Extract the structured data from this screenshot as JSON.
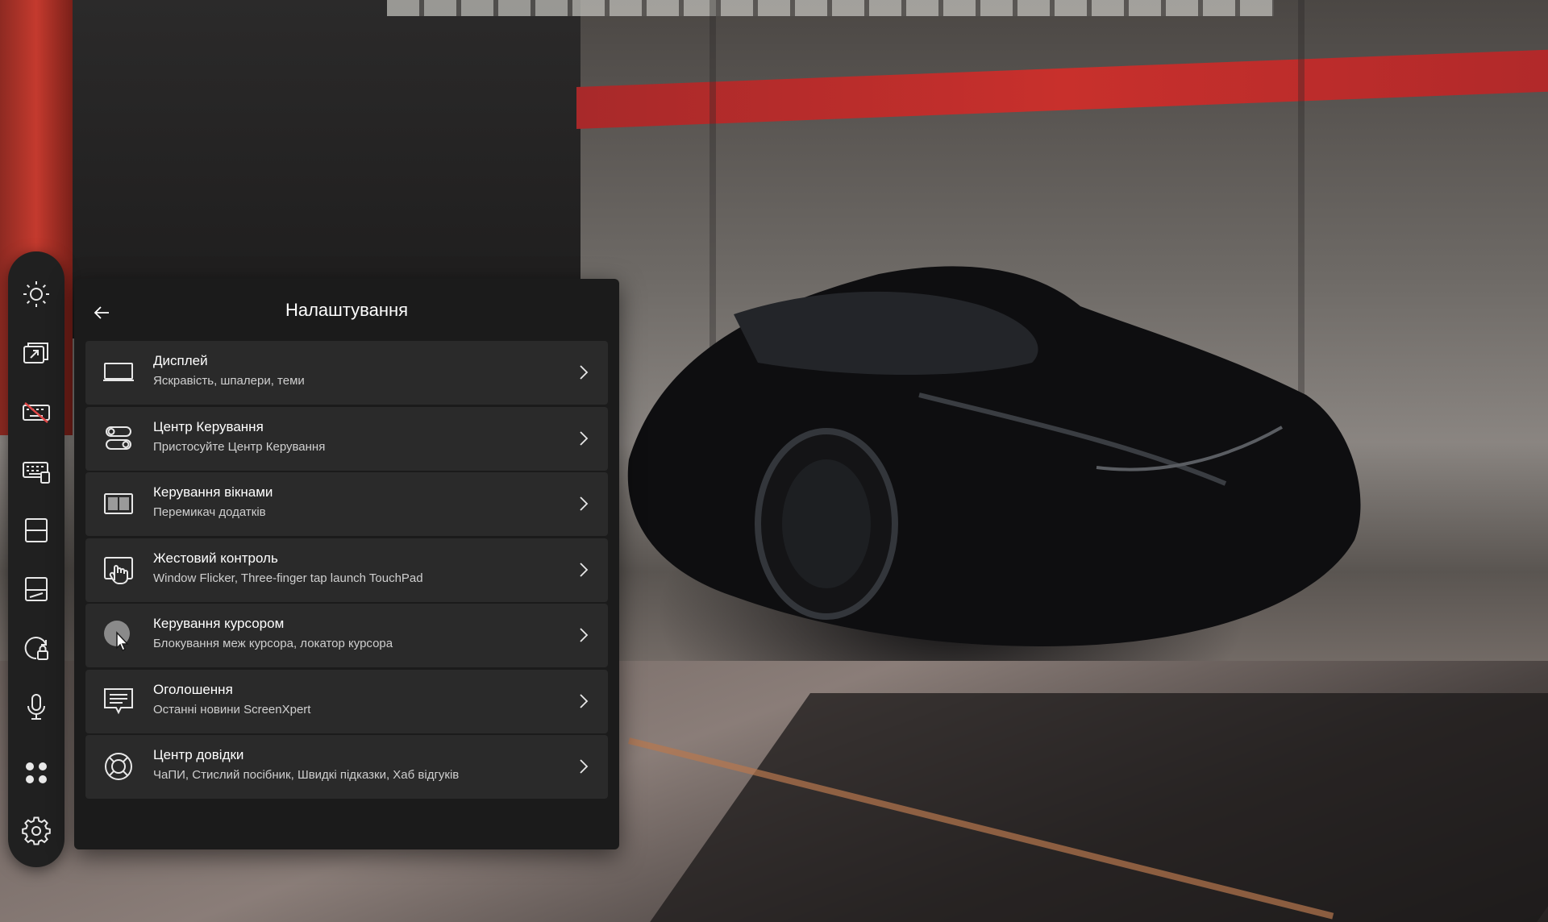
{
  "wallpaper": {
    "description_icon": "sports-car-wallpaper"
  },
  "toolbar": {
    "buttons": [
      {
        "name": "brightness-icon",
        "icon": "sun"
      },
      {
        "name": "window-switch-icon",
        "icon": "windows-stack-arrow"
      },
      {
        "name": "keyboard-off-icon",
        "icon": "keyboard-slash"
      },
      {
        "name": "keyboard-icon",
        "icon": "keyboard"
      },
      {
        "name": "screen-split-icon",
        "icon": "split-horizontal"
      },
      {
        "name": "screen-pad-icon",
        "icon": "screenpad"
      },
      {
        "name": "app-lock-icon",
        "icon": "circular-lock"
      },
      {
        "name": "microphone-icon",
        "icon": "microphone"
      },
      {
        "name": "apps-icon",
        "icon": "four-dots"
      },
      {
        "name": "settings-gear-icon",
        "icon": "gear"
      }
    ]
  },
  "panel": {
    "title": "Налаштування",
    "back_icon": "arrow-left",
    "items": [
      {
        "title": "Дисплей",
        "subtitle": "Яскравість, шпалери, теми",
        "icon": "display"
      },
      {
        "title": "Центр Керування",
        "subtitle": "Пристосуйте Центр Керування",
        "icon": "toggles"
      },
      {
        "title": "Керування вікнами",
        "subtitle": "Перемикач додатків",
        "icon": "window-split"
      },
      {
        "title": "Жестовий контроль",
        "subtitle": "Window Flicker, Three-finger tap launch TouchPad",
        "icon": "gesture-hand"
      },
      {
        "title": "Керування курсором",
        "subtitle": "Блокування меж курсора, локатор курсора",
        "icon": "cursor"
      },
      {
        "title": "Оголошення",
        "subtitle": "Останні новини ScreenXpert",
        "icon": "announcement"
      },
      {
        "title": "Центр довідки",
        "subtitle": "ЧаПИ, Стислий посібник, Швидкі підказки, Хаб відгуків",
        "icon": "lifebuoy"
      }
    ]
  },
  "colors": {
    "panel_bg": "#1b1b1b",
    "item_bg": "#2a2a2a",
    "toolbar_bg": "#202020",
    "text_primary": "#ffffff",
    "text_secondary": "#cfcfcf"
  }
}
